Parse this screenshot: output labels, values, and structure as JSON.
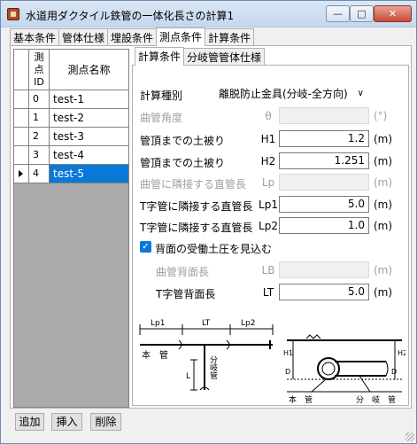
{
  "window": {
    "title": "水道用ダクタイル鉄管の一体化長さの計算1",
    "min_glyph": "—",
    "max_glyph": "□",
    "close_glyph": "✕"
  },
  "main_tabs": [
    {
      "label": "基本条件"
    },
    {
      "label": "管体仕様"
    },
    {
      "label": "埋設条件"
    },
    {
      "label": "測点条件"
    },
    {
      "label": "計算条件"
    }
  ],
  "grid": {
    "id_header": [
      "測",
      "点",
      "ID"
    ],
    "name_header": "測点名称",
    "rows": [
      {
        "id": "0",
        "name": "test-1"
      },
      {
        "id": "1",
        "name": "test-2"
      },
      {
        "id": "2",
        "name": "test-3"
      },
      {
        "id": "3",
        "name": "test-4"
      },
      {
        "id": "4",
        "name": "test-5"
      }
    ]
  },
  "sub_tabs": [
    {
      "label": "計算条件"
    },
    {
      "label": "分岐管管体仕様"
    }
  ],
  "form": {
    "calc_type_label": "計算種別",
    "calc_type_value": "離脱防止金具(分岐-全方向)",
    "bend_angle": {
      "label": "曲管角度",
      "sym": "θ",
      "value": "",
      "unit": "(°)"
    },
    "cover_h1": {
      "label": "管頂までの土被り",
      "sym": "H1",
      "value": "1.2",
      "unit": "(m)"
    },
    "cover_h2": {
      "label": "管頂までの土被り",
      "sym": "H2",
      "value": "1.251",
      "unit": "(m)"
    },
    "lp": {
      "label": "曲管に隣接する直管長",
      "sym": "Lp",
      "value": "",
      "unit": "(m)"
    },
    "lp1": {
      "label": "T字管に隣接する直管長",
      "sym": "Lp1",
      "value": "5.0",
      "unit": "(m)"
    },
    "lp2": {
      "label": "T字管に隣接する直管長",
      "sym": "Lp2",
      "value": "1.0",
      "unit": "(m)"
    },
    "passive_check_label": "背面の受働土圧を見込む",
    "lb": {
      "label": "曲管背面長",
      "sym": "LB",
      "value": "",
      "unit": "(m)"
    },
    "lt": {
      "label": "T字管背面長",
      "sym": "LT",
      "value": "5.0",
      "unit": "(m)"
    }
  },
  "diagram": {
    "lp1": "Lp1",
    "lt": "LT",
    "lp2": "Lp2",
    "l": "L",
    "main_pipe": "本　管",
    "branch_pipe": "分岐管",
    "main_pipe_v": "本　管",
    "branch_pipe_v": "分　岐　管",
    "h1": "H1",
    "h2": "H2",
    "d": "D"
  },
  "buttons": {
    "add": "追加",
    "insert": "挿入",
    "delete": "削除"
  }
}
